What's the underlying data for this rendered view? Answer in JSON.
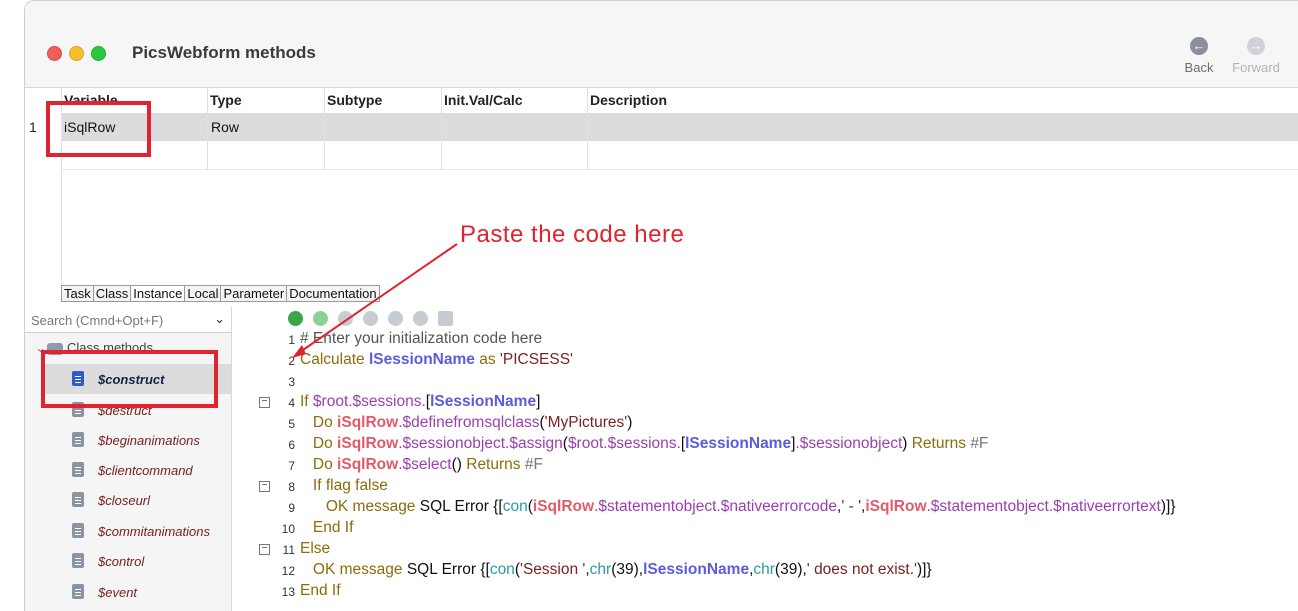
{
  "window": {
    "title": "PicsWebform methods",
    "back_label": "Back",
    "forward_label": "Forward"
  },
  "variables": {
    "columns": [
      "Variable",
      "Type",
      "Subtype",
      "Init.Val/Calc",
      "Description"
    ],
    "rows": [
      {
        "num": "1",
        "variable": "iSqlRow",
        "type": "Row",
        "subtype": "",
        "init": "",
        "description": ""
      }
    ]
  },
  "tabs": [
    "Task",
    "Class",
    "Instance",
    "Local",
    "Parameter",
    "Documentation"
  ],
  "active_tab": "Instance",
  "sidebar": {
    "search_placeholder": "Search (Cmnd+Opt+F)",
    "group_label": "Class methods",
    "methods": [
      "$construct",
      "$destruct",
      "$beginanimations",
      "$clientcommand",
      "$closeurl",
      "$commitanimations",
      "$control",
      "$event"
    ],
    "selected": "$construct"
  },
  "annotation": {
    "text": "Paste the code here",
    "color": "#e0232f"
  },
  "code_lines": [
    "1",
    "2",
    "3",
    "4",
    "5",
    "6",
    "7",
    "8",
    "9",
    "10",
    "11",
    "12",
    "13"
  ]
}
